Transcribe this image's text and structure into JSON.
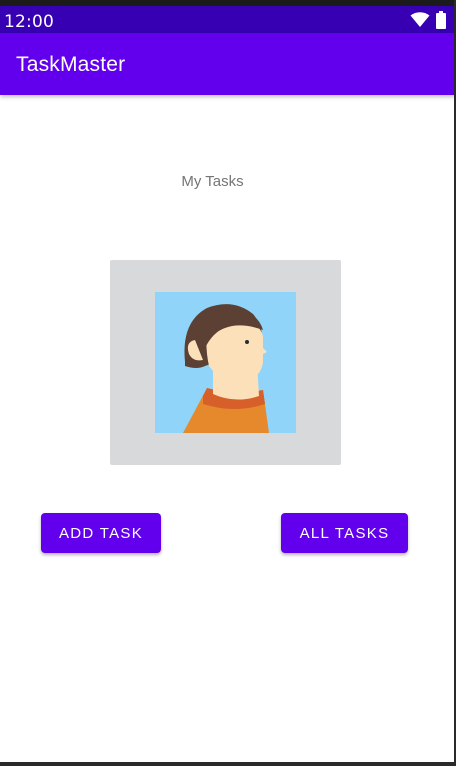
{
  "status_bar": {
    "time": "12:00",
    "icons": [
      "wifi-icon",
      "battery-icon"
    ],
    "background": "#3700b3"
  },
  "app_bar": {
    "title": "TaskMaster",
    "background": "#6200ee"
  },
  "main": {
    "heading": "My Tasks",
    "avatar": {
      "description": "avatar-image",
      "frame_color": "#d7d9da",
      "background_color": "#90d4f9"
    },
    "buttons": {
      "add_task": "ADD TASK",
      "all_tasks": "ALL TASKS"
    },
    "accent": "#6200ee"
  }
}
